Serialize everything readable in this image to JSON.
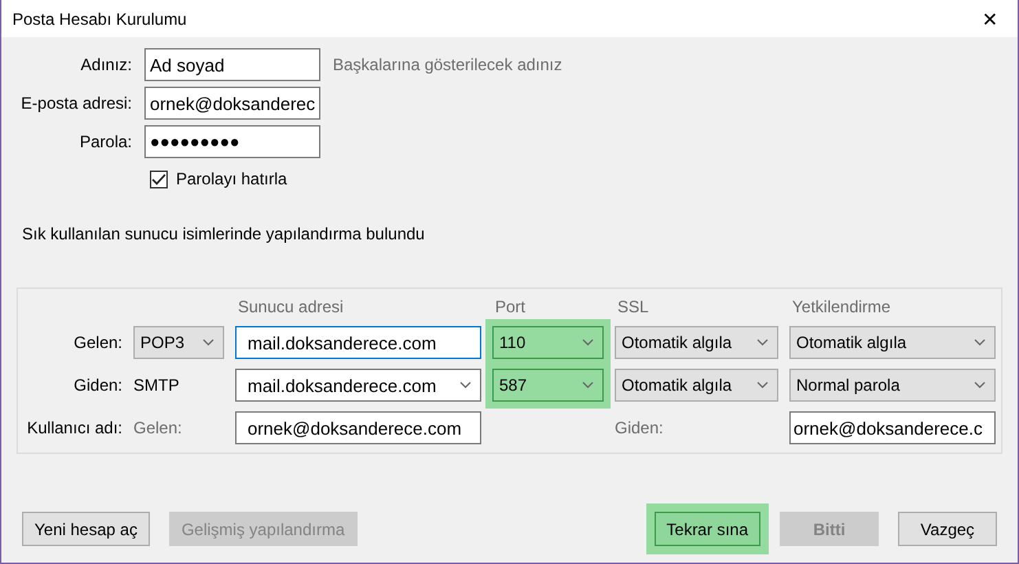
{
  "window": {
    "title": "Posta Hesabı Kurulumu",
    "close": "✕"
  },
  "account": {
    "fields": [
      {
        "label": "Adınız:",
        "value": "Ad soyad",
        "hint": "Başkalarına gösterilecek adınız"
      },
      {
        "label": "E-posta adresi:",
        "value": "ornek@doksanderec"
      },
      {
        "label": "Parola:",
        "value": "●●●●●●●●●"
      }
    ],
    "remember": {
      "label": "Parolayı hatırla",
      "checked": true
    }
  },
  "message": "Sık kullanılan sunucu isimlerinde yapılandırma bulundu",
  "servers": {
    "columns": [
      "Sunucu adresi",
      "Port",
      "SSL",
      "Yetkilendirme"
    ],
    "rows": [
      {
        "label": "Gelen:",
        "protocol": {
          "kind": "select",
          "value": "POP3"
        },
        "server": {
          "kind": "input",
          "value": "mail.doksanderece.com",
          "focused": true
        },
        "port": {
          "value": "110",
          "highlighted": true
        },
        "ssl": "Otomatik algıla",
        "auth": "Otomatik algıla"
      },
      {
        "label": "Giden:",
        "protocol": {
          "kind": "text",
          "value": "SMTP"
        },
        "server": {
          "kind": "combo",
          "value": "mail.doksanderece.com",
          "focused": false
        },
        "port": {
          "value": "587",
          "highlighted": true
        },
        "ssl": "Otomatik algıla",
        "auth": "Normal parola"
      }
    ],
    "username": {
      "label": "Kullanıcı adı:",
      "incoming_label": "Gelen:",
      "incoming_value": "ornek@doksanderece.com",
      "outgoing_label": "Giden:",
      "outgoing_value": "ornek@doksanderece.c"
    }
  },
  "buttons": [
    {
      "label": "Yeni hesap aç",
      "disabled": false,
      "highlighted": false
    },
    {
      "label": "Gelişmiş yapılandırma",
      "disabled": true,
      "highlighted": false
    },
    {
      "label": "Tekrar sına",
      "disabled": false,
      "highlighted": true
    },
    {
      "label": "Bitti",
      "disabled": true,
      "highlighted": false
    },
    {
      "label": "Vazgeç",
      "disabled": false,
      "highlighted": false
    }
  ]
}
